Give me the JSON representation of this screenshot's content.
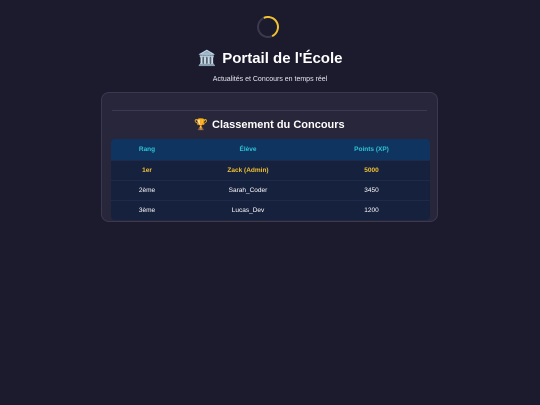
{
  "header": {
    "title_icon": "🏛️",
    "title": "Portail de l'École",
    "subtitle": "Actualités et Concours en temps réel"
  },
  "leaderboard": {
    "icon": "🏆",
    "title": "Classement du Concours",
    "columns": [
      "Rang",
      "Élève",
      "Points (XP)"
    ],
    "rows": [
      {
        "rank": "1er",
        "student": "Zack (Admin)",
        "points": "5000"
      },
      {
        "rank": "2ème",
        "student": "Sarah_Coder",
        "points": "3450"
      },
      {
        "rank": "3ème",
        "student": "Lucas_Dev",
        "points": "1200"
      }
    ]
  },
  "colors": {
    "background": "#1c1b2e",
    "accent_gold": "#f2c230",
    "header_text": "#2ec4d6",
    "table_header_bg": "#0f3460",
    "table_row_bg": "#16213e"
  }
}
